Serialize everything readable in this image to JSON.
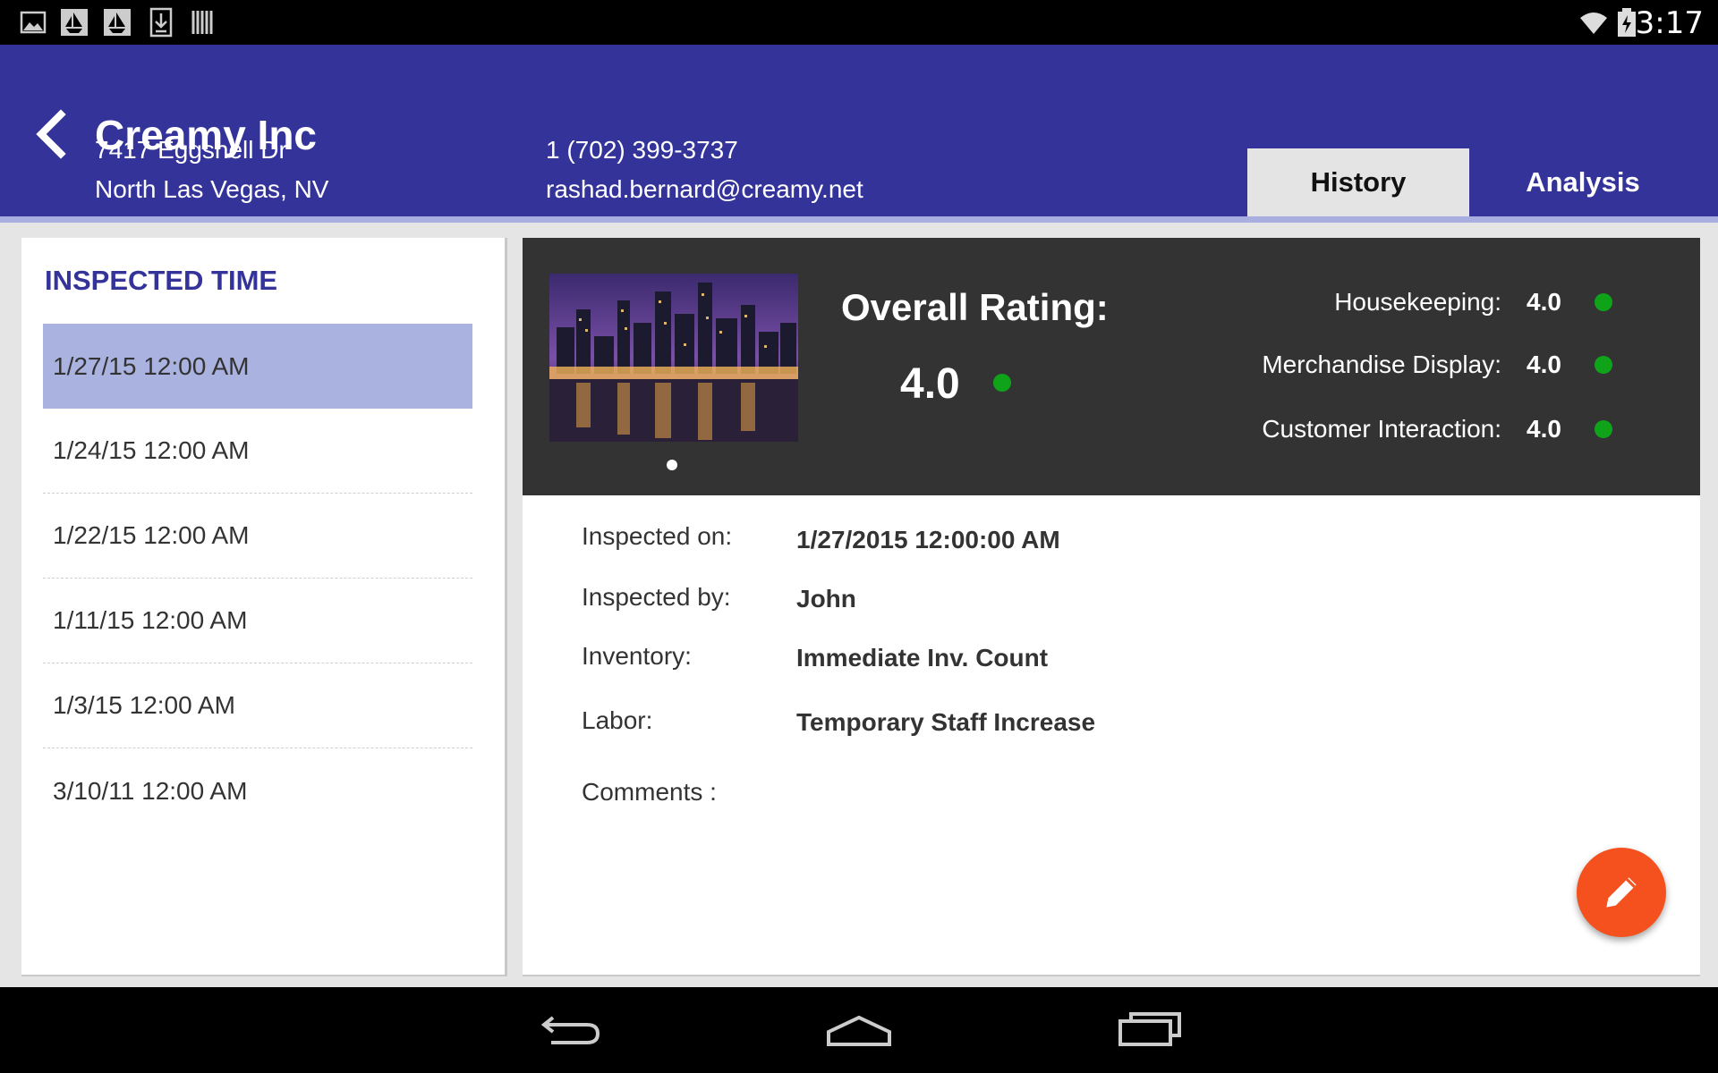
{
  "status_bar": {
    "time": "3:17",
    "left_icons": [
      "image-icon",
      "sailboat-icon",
      "sailboat-icon",
      "download-icon",
      "barcode-icon"
    ],
    "right_icons": [
      "wifi-icon",
      "battery-charging-icon"
    ]
  },
  "header": {
    "title": "Creamy Inc",
    "address_line1": "7417 Eggshell Dr",
    "address_line2": "North Las Vegas, NV",
    "phone": "1 (702) 399-3737",
    "email": "rashad.bernard@creamy.net",
    "tabs": [
      {
        "label": "History",
        "active": true
      },
      {
        "label": "Analysis",
        "active": false
      }
    ]
  },
  "inspections": {
    "title": "INSPECTED TIME",
    "items": [
      {
        "label": "1/27/15 12:00 AM",
        "selected": true
      },
      {
        "label": "1/24/15 12:00 AM",
        "selected": false
      },
      {
        "label": "1/22/15 12:00 AM",
        "selected": false
      },
      {
        "label": "1/11/15 12:00 AM",
        "selected": false
      },
      {
        "label": "1/3/15 12:00 AM",
        "selected": false
      },
      {
        "label": "3/10/11 12:00 AM",
        "selected": false
      }
    ]
  },
  "rating": {
    "overall_label": "Overall Rating:",
    "overall_value": "4.0",
    "categories": [
      {
        "label": "Housekeeping:",
        "value": "4.0"
      },
      {
        "label": "Merchandise Display:",
        "value": "4.0"
      },
      {
        "label": "Customer Interaction:",
        "value": "4.0"
      }
    ],
    "status_color": "#0fa31a"
  },
  "details": {
    "inspected_on_label": "Inspected on:",
    "inspected_on_value": "1/27/2015 12:00:00 AM",
    "inspected_by_label": "Inspected by:",
    "inspected_by_value": "John",
    "inventory_label": "Inventory:",
    "inventory_value": "Immediate Inv. Count",
    "labor_label": "Labor:",
    "labor_value": "Temporary Staff Increase",
    "comments_label": "Comments :"
  },
  "colors": {
    "header_bg": "#343399",
    "accent_text": "#343399",
    "selected_row": "#aab2e0",
    "fab": "#f4511e",
    "rating_bar": "#333333"
  }
}
